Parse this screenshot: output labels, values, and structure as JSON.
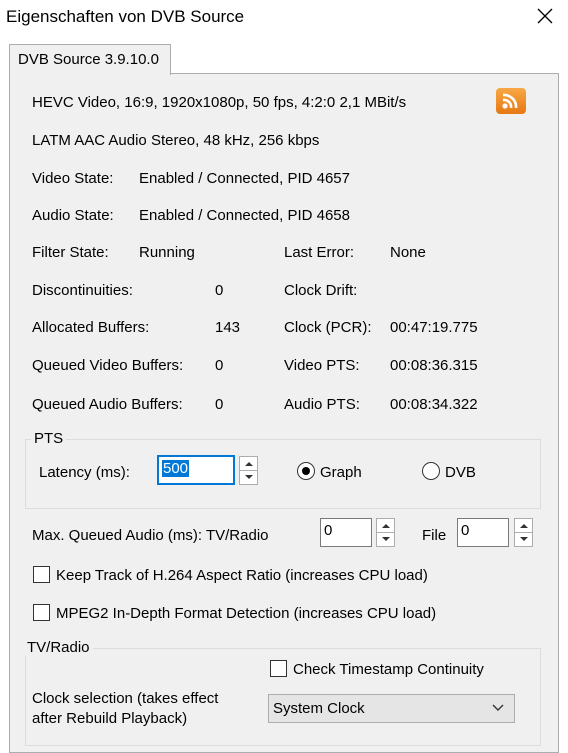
{
  "window": {
    "title": "Eigenschaften von DVB Source",
    "close_icon": "close-icon"
  },
  "tab": {
    "label": "DVB Source 3.9.10.0"
  },
  "info": {
    "video_format": "HEVC Video, 16:9, 1920x1080p, 50 fps, 4:2:0   2,1 MBit/s",
    "audio_format": "LATM AAC Audio Stereo, 48 kHz, 256 kbps",
    "video_state_label": "Video State:",
    "video_state_value": "Enabled / Connected, PID 4657",
    "audio_state_label": "Audio State:",
    "audio_state_value": "Enabled / Connected, PID 4658",
    "filter_state_label": "Filter State:",
    "filter_state_value": "Running",
    "last_error_label": "Last Error:",
    "last_error_value": "None",
    "discontinuities_label": "Discontinuities:",
    "discontinuities_value": "0",
    "clock_drift_label": "Clock Drift:",
    "clock_drift_value": "",
    "allocated_buffers_label": "Allocated Buffers:",
    "allocated_buffers_value": "143",
    "clock_pcr_label": "Clock (PCR):",
    "clock_pcr_value": "00:47:19.775",
    "queued_video_label": "Queued Video Buffers:",
    "queued_video_value": "0",
    "video_pts_label": "Video PTS:",
    "video_pts_value": "00:08:36.315",
    "queued_audio_label": "Queued Audio Buffers:",
    "queued_audio_value": "0",
    "audio_pts_label": "Audio PTS:",
    "audio_pts_value": "00:08:34.322",
    "rss_icon": "rss-icon",
    "rss_color": "#f39a2e"
  },
  "pts": {
    "group_title": "PTS",
    "latency_label": "Latency (ms):",
    "latency_value": "500",
    "graph_label": "Graph",
    "dvb_label": "DVB",
    "selected": "Graph"
  },
  "queued_audio_settings": {
    "label": "Max. Queued Audio (ms): TV/Radio",
    "tv_radio_value": "0",
    "file_label": "File",
    "file_value": "0"
  },
  "options": {
    "keep_track_label": "Keep Track of H.264 Aspect Ratio (increases CPU load)",
    "keep_track_checked": false,
    "mpeg2_label": "MPEG2 In-Depth Format Detection (increases CPU load)",
    "mpeg2_checked": false
  },
  "tv_radio": {
    "group_title": "TV/Radio",
    "check_timestamp_label": "Check Timestamp Continuity",
    "check_timestamp_checked": false,
    "clock_selection_label_line1": "Clock selection (takes effect",
    "clock_selection_label_line2": "after Rebuild Playback)",
    "clock_value": "System Clock"
  },
  "colors": {
    "panel_bg": "#f0f0f0",
    "focus_border": "#0078d7",
    "selection_bg": "#0078d7"
  }
}
